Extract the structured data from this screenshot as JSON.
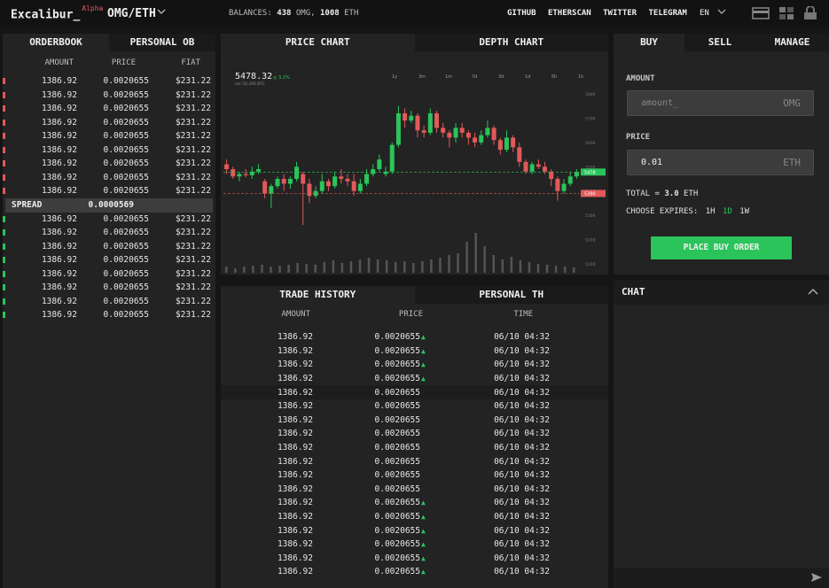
{
  "header": {
    "brand": "Excalibur_",
    "brand_badge": "Alpha",
    "pair": "OMG/ETH",
    "balances_label": "BALANCES:",
    "balance_omg": "438",
    "balance_omg_unit": "OMG,",
    "balance_eth": "1008",
    "balance_eth_unit": "ETH",
    "links": [
      "GITHUB",
      "ETHERSCAN",
      "TWITTER",
      "TELEGRAM"
    ],
    "lang": "EN"
  },
  "orderbook": {
    "tabs": [
      "ORDERBOOK",
      "PERSONAL OB"
    ],
    "columns": [
      "AMOUNT",
      "PRICE",
      "FIAT"
    ],
    "asks": [
      [
        "1386.92",
        "0.0020655",
        "$231.22"
      ],
      [
        "1386.92",
        "0.0020655",
        "$231.22"
      ],
      [
        "1386.92",
        "0.0020655",
        "$231.22"
      ],
      [
        "1386.92",
        "0.0020655",
        "$231.22"
      ],
      [
        "1386.92",
        "0.0020655",
        "$231.22"
      ],
      [
        "1386.92",
        "0.0020655",
        "$231.22"
      ],
      [
        "1386.92",
        "0.0020655",
        "$231.22"
      ],
      [
        "1386.92",
        "0.0020655",
        "$231.22"
      ],
      [
        "1386.92",
        "0.0020655",
        "$231.22"
      ]
    ],
    "spread_label": "SPREAD",
    "spread_value": "0.0000569",
    "bids": [
      [
        "1386.92",
        "0.0020655",
        "$231.22"
      ],
      [
        "1386.92",
        "0.0020655",
        "$231.22"
      ],
      [
        "1386.92",
        "0.0020655",
        "$231.22"
      ],
      [
        "1386.92",
        "0.0020655",
        "$231.22"
      ],
      [
        "1386.92",
        "0.0020655",
        "$231.22"
      ],
      [
        "1386.92",
        "0.0020655",
        "$231.22"
      ],
      [
        "1386.92",
        "0.0020655",
        "$231.22"
      ],
      [
        "1386.92",
        "0.0020655",
        "$231.22"
      ]
    ],
    "ask_color": "#e05a5a",
    "bid_color": "#2bc45b"
  },
  "chart": {
    "tabs": [
      "PRICE CHART",
      "DEPTH CHART"
    ],
    "last_price": "5478.32",
    "change": "3.2%",
    "volume": "vol 50,390 BTC",
    "ranges": [
      "1y",
      "3m",
      "1m",
      "7d",
      "3d",
      "1d",
      "6h",
      "1h"
    ],
    "yticks": [
      "5800",
      "5700",
      "5600",
      "5500",
      "5400",
      "5300",
      "5200",
      "5100"
    ],
    "current_marker": "5478",
    "low_marker": "5390",
    "up_color": "#2bc45b",
    "down_color": "#e05a5a",
    "candles": [
      [
        5510,
        5490,
        5530,
        5470
      ],
      [
        5490,
        5460,
        5500,
        5450
      ],
      [
        5460,
        5470,
        5480,
        5440
      ],
      [
        5470,
        5465,
        5490,
        5455
      ],
      [
        5465,
        5480,
        5500,
        5450
      ],
      [
        5480,
        5490,
        5510,
        5470
      ],
      [
        5440,
        5390,
        5450,
        5370
      ],
      [
        5390,
        5420,
        5430,
        5330
      ],
      [
        5420,
        5450,
        5460,
        5410
      ],
      [
        5450,
        5430,
        5470,
        5400
      ],
      [
        5430,
        5450,
        5460,
        5410
      ],
      [
        5450,
        5500,
        5520,
        5440
      ],
      [
        5470,
        5430,
        5480,
        5260
      ],
      [
        5430,
        5380,
        5450,
        5350
      ],
      [
        5380,
        5400,
        5420,
        5370
      ],
      [
        5400,
        5440,
        5470,
        5390
      ],
      [
        5440,
        5420,
        5450,
        5400
      ],
      [
        5420,
        5460,
        5480,
        5410
      ],
      [
        5460,
        5450,
        5490,
        5430
      ],
      [
        5450,
        5440,
        5470,
        5420
      ],
      [
        5440,
        5400,
        5470,
        5380
      ],
      [
        5400,
        5430,
        5450,
        5390
      ],
      [
        5430,
        5470,
        5490,
        5420
      ],
      [
        5470,
        5490,
        5510,
        5460
      ],
      [
        5490,
        5530,
        5550,
        5480
      ],
      [
        5470,
        5480,
        5500,
        5460
      ],
      [
        5480,
        5590,
        5600,
        5470
      ],
      [
        5590,
        5720,
        5750,
        5580
      ],
      [
        5720,
        5690,
        5740,
        5660
      ],
      [
        5690,
        5710,
        5730,
        5680
      ],
      [
        5710,
        5650,
        5720,
        5620
      ],
      [
        5650,
        5640,
        5670,
        5620
      ],
      [
        5640,
        5720,
        5740,
        5630
      ],
      [
        5720,
        5660,
        5730,
        5640
      ],
      [
        5660,
        5640,
        5680,
        5620
      ],
      [
        5640,
        5620,
        5650,
        5580
      ],
      [
        5620,
        5660,
        5680,
        5600
      ],
      [
        5660,
        5640,
        5680,
        5620
      ],
      [
        5640,
        5620,
        5650,
        5590
      ],
      [
        5620,
        5600,
        5640,
        5580
      ],
      [
        5600,
        5630,
        5650,
        5590
      ],
      [
        5630,
        5660,
        5690,
        5620
      ],
      [
        5660,
        5610,
        5670,
        5590
      ],
      [
        5610,
        5570,
        5620,
        5550
      ],
      [
        5570,
        5620,
        5650,
        5560
      ],
      [
        5620,
        5580,
        5630,
        5560
      ],
      [
        5580,
        5520,
        5600,
        5500
      ],
      [
        5520,
        5480,
        5530,
        5470
      ],
      [
        5480,
        5510,
        5520,
        5470
      ],
      [
        5510,
        5500,
        5530,
        5490
      ],
      [
        5500,
        5480,
        5520,
        5470
      ],
      [
        5480,
        5450,
        5490,
        5420
      ],
      [
        5450,
        5400,
        5460,
        5360
      ],
      [
        5400,
        5430,
        5450,
        5390
      ],
      [
        5430,
        5460,
        5480,
        5420
      ],
      [
        5460,
        5478,
        5490,
        5450
      ]
    ],
    "volumes": [
      0.14,
      0.1,
      0.14,
      0.16,
      0.18,
      0.14,
      0.16,
      0.18,
      0.22,
      0.2,
      0.18,
      0.24,
      0.28,
      0.22,
      0.26,
      0.3,
      0.34,
      0.3,
      0.28,
      0.24,
      0.26,
      0.22,
      0.26,
      0.3,
      0.34,
      0.4,
      0.44,
      0.7,
      0.9,
      0.6,
      0.4,
      0.3,
      0.36,
      0.28,
      0.24,
      0.2,
      0.18,
      0.16,
      0.14,
      0.12
    ]
  },
  "trade_history": {
    "tabs": [
      "TRADE HISTORY",
      "PERSONAL TH"
    ],
    "columns": [
      "AMOUNT",
      "PRICE",
      "TIME"
    ],
    "rows": [
      {
        "amount": "1386.92",
        "price": "0.0020655",
        "up": true,
        "time": "06/10 04:32"
      },
      {
        "amount": "1386.92",
        "price": "0.0020655",
        "up": true,
        "time": "06/10 04:32"
      },
      {
        "amount": "1386.92",
        "price": "0.0020655",
        "up": true,
        "time": "06/10 04:32"
      },
      {
        "amount": "1386.92",
        "price": "0.0020655",
        "up": true,
        "time": "06/10 04:32"
      },
      {
        "amount": "1386.92",
        "price": "0.0020655",
        "up": false,
        "time": "06/10 04:32"
      },
      {
        "amount": "1386.92",
        "price": "0.0020655",
        "up": false,
        "time": "06/10 04:32"
      },
      {
        "amount": "1386.92",
        "price": "0.0020655",
        "up": false,
        "time": "06/10 04:32"
      },
      {
        "amount": "1386.92",
        "price": "0.0020655",
        "up": false,
        "time": "06/10 04:32"
      },
      {
        "amount": "1386.92",
        "price": "0.0020655",
        "up": false,
        "time": "06/10 04:32"
      },
      {
        "amount": "1386.92",
        "price": "0.0020655",
        "up": false,
        "time": "06/10 04:32"
      },
      {
        "amount": "1386.92",
        "price": "0.0020655",
        "up": false,
        "time": "06/10 04:32"
      },
      {
        "amount": "1386.92",
        "price": "0.0020655",
        "up": false,
        "time": "06/10 04:32"
      },
      {
        "amount": "1386.92",
        "price": "0.0020655",
        "up": true,
        "time": "06/10 04:32"
      },
      {
        "amount": "1386.92",
        "price": "0.0020655",
        "up": true,
        "time": "06/10 04:32"
      },
      {
        "amount": "1386.92",
        "price": "0.0020655",
        "up": true,
        "time": "06/10 04:32"
      },
      {
        "amount": "1386.92",
        "price": "0.0020655",
        "up": true,
        "time": "06/10 04:32"
      },
      {
        "amount": "1386.92",
        "price": "0.0020655",
        "up": true,
        "time": "06/10 04:32"
      },
      {
        "amount": "1386.92",
        "price": "0.0020655",
        "up": true,
        "time": "06/10 04:32"
      }
    ]
  },
  "order_form": {
    "tabs": [
      "BUY",
      "SELL",
      "MANAGE"
    ],
    "amount_label": "AMOUNT",
    "amount_placeholder": "amount_",
    "amount_unit": "OMG",
    "price_label": "PRICE",
    "price_value": "0.01",
    "price_unit": "ETH",
    "total_label": "TOTAL = ",
    "total_value": "3.0",
    "total_unit": "ETH",
    "expires_label": "CHOOSE EXPIRES:",
    "expires_options": [
      "1H",
      "1D",
      "1W"
    ],
    "expires_selected": "1D",
    "submit": "PLACE BUY ORDER",
    "accent": "#2bc45b"
  },
  "chat": {
    "title": "CHAT"
  }
}
